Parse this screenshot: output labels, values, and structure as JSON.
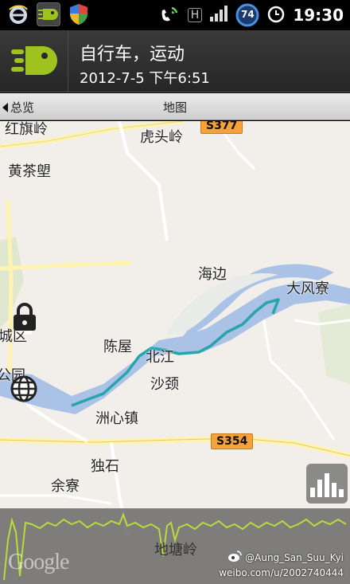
{
  "statusbar": {
    "time": "19:30",
    "battery_level": "74",
    "network_type": "H",
    "icons": [
      "ie-browser-icon",
      "app-notification-icon",
      "shield-app-icon",
      "wifi-call-icon",
      "network-h-icon",
      "signal-icon",
      "battery-icon",
      "alarm-icon"
    ]
  },
  "header": {
    "title": "自行车，运动",
    "subtitle": "2012-7-5 下午6:51",
    "logo_color": "#9ec31f"
  },
  "nav": {
    "back_label": "总览",
    "title": "地图"
  },
  "map": {
    "places": {
      "hongqiling": "红旗岭",
      "hutouling": "虎头岭",
      "huangchatang": "黄茶塱",
      "haibian": "海边",
      "dafengliao": "大风寮",
      "chengqu": "城区",
      "chenwu": "陈屋",
      "beijiang": "北江",
      "shajing": "沙颈",
      "gongyuan": "公园",
      "zhouxinzhen": "洲心镇",
      "dushi": "独石",
      "yuliao": "余寮",
      "ditangling": "地塘岭"
    },
    "roads": {
      "s377": "S377",
      "s354": "S354"
    },
    "route_color": "#27a4ac",
    "river_color": "#a9c2e6"
  },
  "overlay": {
    "google_logo": "Google",
    "weibo_handle": "@Aung_San_Suu_Kyi",
    "weibo_url": "weibo.com/u/2002740444",
    "elevation_color": "#b8dc3c"
  }
}
